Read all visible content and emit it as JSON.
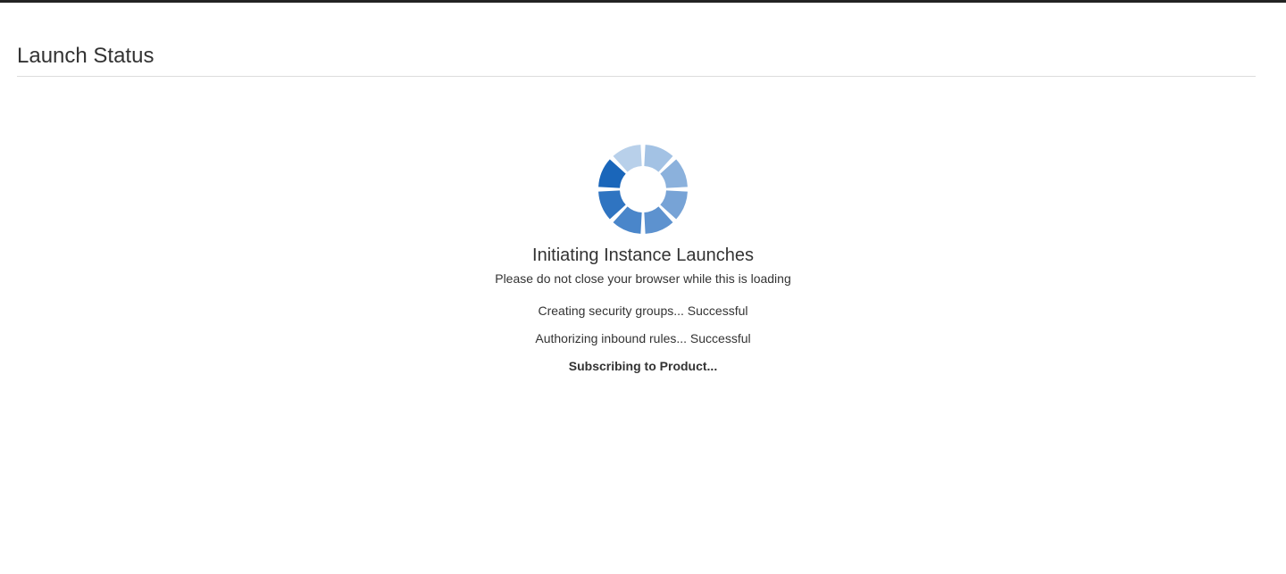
{
  "header": {
    "title": "Launch Status"
  },
  "status": {
    "heading": "Initiating Instance Launches",
    "subheading": "Please do not close your browser while this is loading",
    "steps": [
      {
        "text": "Creating security groups... Successful",
        "state": "done"
      },
      {
        "text": "Authorizing inbound rules... Successful",
        "state": "done"
      },
      {
        "text": "Subscribing to Product...",
        "state": "in-progress"
      }
    ]
  },
  "colors": {
    "top_bar": "#232323",
    "spinner_segments": [
      "#b8d0ea",
      "#a3c2e4",
      "#8bb1dc",
      "#77a3d6",
      "#5d92cf",
      "#4a86ca",
      "#2f74c1",
      "#1a66ba"
    ]
  }
}
